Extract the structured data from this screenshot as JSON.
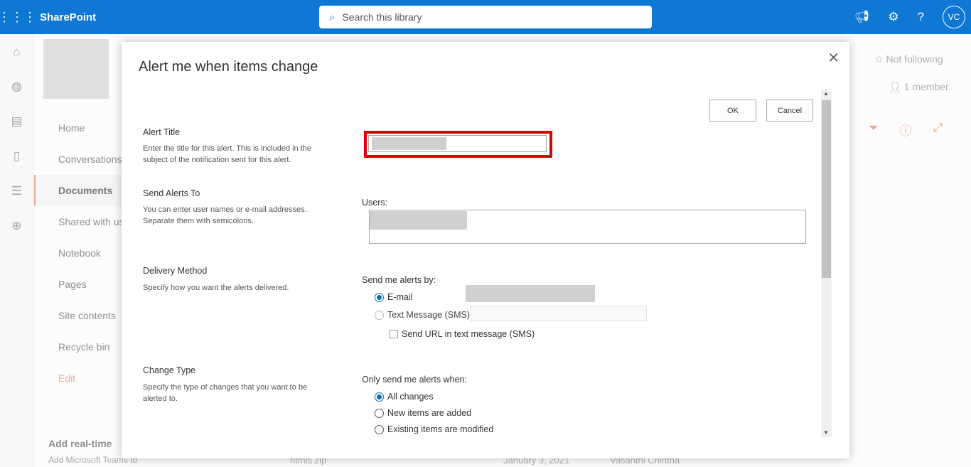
{
  "header": {
    "app": "SharePoint",
    "search_placeholder": "Search this library",
    "avatar": "VC"
  },
  "site": {
    "following": "Not following",
    "members": "1 member"
  },
  "nav": [
    "Home",
    "Conversations",
    "Documents",
    "Shared with us",
    "Notebook",
    "Pages",
    "Site contents",
    "Recycle bin",
    "Edit"
  ],
  "teams": {
    "title": "Add real-time",
    "sub": "Add Microsoft Teams to"
  },
  "bg_row": {
    "name": "htmls.zip",
    "date": "January 3, 2021",
    "author": "Vasanthi Chintha"
  },
  "dialog": {
    "title": "Alert me when items change",
    "ok": "OK",
    "cancel": "Cancel",
    "alert_title": {
      "label": "Alert Title",
      "desc": "Enter the title for this alert. This is included in the subject of the notification sent for this alert."
    },
    "send_to": {
      "label": "Send Alerts To",
      "desc": "You can enter user names or e-mail addresses. Separate them with semicolons.",
      "users_label": "Users:"
    },
    "delivery": {
      "label": "Delivery Method",
      "desc": "Specify how you want the alerts delivered.",
      "send_by": "Send me alerts by:",
      "email": "E-mail",
      "sms": "Text Message (SMS)",
      "send_url": "Send URL in text message (SMS)",
      "selected": "E-mail"
    },
    "change_type": {
      "label": "Change Type",
      "desc": "Specify the type of changes that you want to be alerted to.",
      "only_when": "Only send me alerts when:",
      "options": [
        "All changes",
        "New items are added",
        "Existing items are modified"
      ],
      "selected": "All changes"
    },
    "highlight_color": "#e00000"
  }
}
